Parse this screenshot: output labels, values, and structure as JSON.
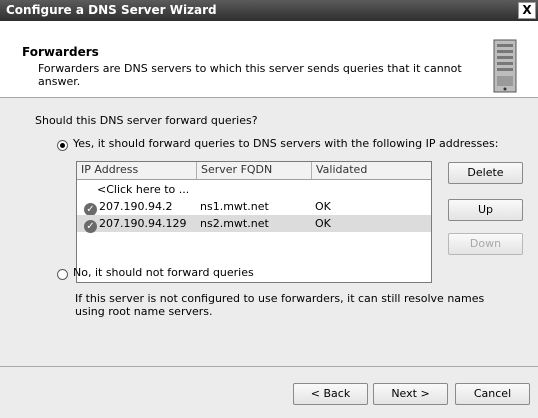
{
  "window": {
    "title": "Configure a DNS Server Wizard",
    "close_label": "X"
  },
  "header": {
    "title": "Forwarders",
    "description": "Forwarders are DNS servers to which this server sends queries that it cannot answer.",
    "icon": "server-icon"
  },
  "question": "Should this DNS server forward queries?",
  "options": {
    "yes": {
      "label": "Yes, it should forward queries to DNS servers with the following IP addresses:",
      "selected": true
    },
    "no": {
      "label": "No, it should not forward queries",
      "selected": false
    }
  },
  "table": {
    "columns": [
      "IP Address",
      "Server FQDN",
      "Validated"
    ],
    "placeholder_row": "<Click here to ...",
    "rows": [
      {
        "ip": "207.190.94.2",
        "fqdn": "ns1.mwt.net",
        "validated": "OK",
        "status_icon": "check-icon",
        "selected": false
      },
      {
        "ip": "207.190.94.129",
        "fqdn": "ns2.mwt.net",
        "validated": "OK",
        "status_icon": "check-icon",
        "selected": true
      }
    ]
  },
  "side_buttons": {
    "delete": "Delete",
    "up": "Up",
    "down": "Down"
  },
  "no_forward_note": "If this server is not configured to use forwarders, it can still resolve names using root name servers.",
  "footer": {
    "back": "< Back",
    "next": "Next >",
    "cancel": "Cancel"
  },
  "colors": {
    "titlebar": "#3c3c3c",
    "selected_row": "#dcdcdc",
    "dialog_bg": "#ececec"
  }
}
